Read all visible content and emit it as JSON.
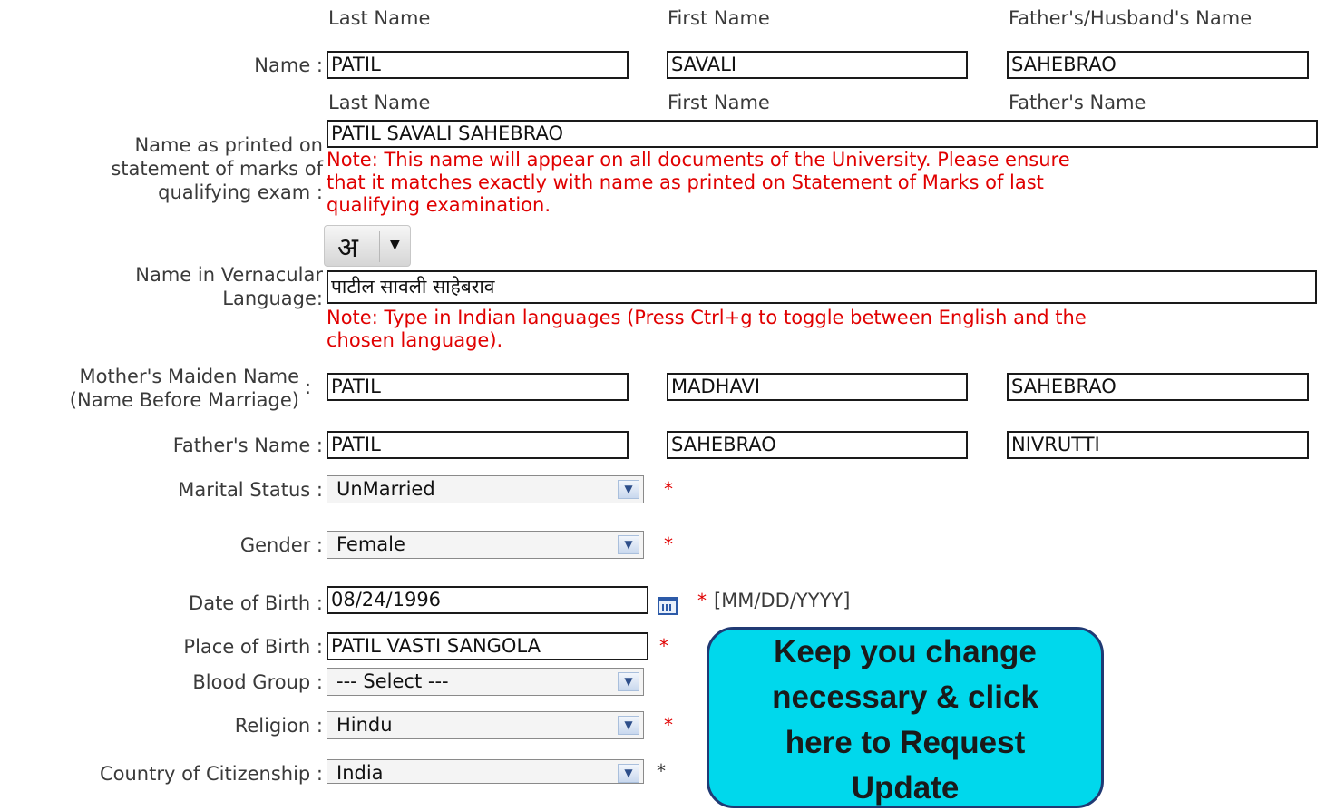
{
  "headers": {
    "row1": {
      "last": "Last Name",
      "first": "First Name",
      "father_husband": "Father's/Husband's Name"
    },
    "row2": {
      "last": "Last Name",
      "first": "First Name",
      "father": "Father's Name"
    }
  },
  "name": {
    "label": "Name :",
    "last": "PATIL",
    "first": "SAVALI",
    "father_husband": "SAHEBRAO"
  },
  "printed_name": {
    "label_lines": [
      "Name as printed on",
      "statement of marks of",
      "qualifying exam :"
    ],
    "value": "PATIL SAVALI SAHEBRAO",
    "note_lines": [
      "Note: This name will appear on all documents of the University. Please ensure",
      "that it matches exactly with name as printed on Statement of Marks of last",
      "qualifying examination."
    ]
  },
  "language_tool": {
    "glyph": "अ",
    "caret": "▼",
    "icon": "language-toggle-icon"
  },
  "vernacular": {
    "label_lines": [
      "Name in Vernacular",
      "Language:"
    ],
    "value": "पाटील  सावली  साहेबराव",
    "note_lines": [
      "Note: Type in Indian languages (Press Ctrl+g to toggle between English and the",
      "chosen language)."
    ]
  },
  "mother": {
    "label_lines": [
      "Mother's Maiden Name",
      "(Name Before Marriage)"
    ],
    "label_colon": ":",
    "last": "PATIL",
    "first": "MADHAVI",
    "father": "SAHEBRAO"
  },
  "father": {
    "label": "Father's Name :",
    "last": "PATIL",
    "first": "SAHEBRAO",
    "father": "NIVRUTTI"
  },
  "marital_status": {
    "label": "Marital Status :",
    "value": "UnMarried",
    "required": "*"
  },
  "gender": {
    "label": "Gender :",
    "value": "Female",
    "required": "*"
  },
  "dob": {
    "label": "Date of Birth :",
    "value": "08/24/1996",
    "required": "*",
    "format": "[MM/DD/YYYY]",
    "icon": "calendar-icon"
  },
  "place_of_birth": {
    "label": "Place of Birth :",
    "value": "PATIL VASTI SANGOLA",
    "required": "*"
  },
  "blood_group": {
    "label": "Blood Group :",
    "value": "--- Select ---"
  },
  "religion": {
    "label": "Religion :",
    "value": "Hindu",
    "required": "*"
  },
  "citizenship": {
    "label": "Country of Citizenship :",
    "value": "India",
    "required": "*"
  },
  "dropdown_arrow": "▼",
  "callout": {
    "lines": [
      "Keep you change",
      "necessary & click",
      "here to Request",
      "Update"
    ],
    "colors": {
      "fill": "#00d8ec",
      "border": "#203a74"
    }
  },
  "colors": {
    "note": "#e00000",
    "required": "#e00000",
    "label": "#3a3a3a"
  }
}
